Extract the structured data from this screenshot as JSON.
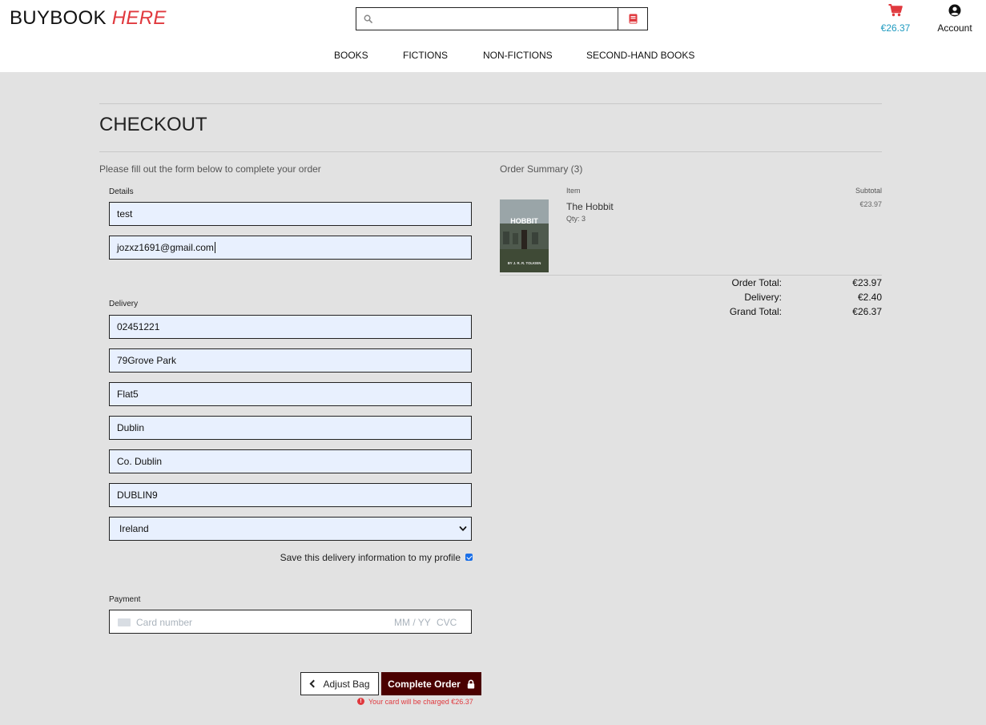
{
  "header": {
    "logo_main": "BUYBOOK",
    "logo_accent": "HERE",
    "search_value": "",
    "cart_amount": "€26.37",
    "account_label": "Account"
  },
  "nav": {
    "items": [
      "BOOKS",
      "FICTIONS",
      "NON-FICTIONS",
      "SECOND-HAND BOOKS"
    ]
  },
  "page": {
    "title": "CHECKOUT",
    "intro": "Please fill out the form below to complete your order"
  },
  "form": {
    "details_label": "Details",
    "full_name": "test",
    "email": "jozxz1691@gmail.com",
    "delivery_label": "Delivery",
    "phone": "02451221",
    "street1": "79Grove Park",
    "street2": "Flat5",
    "town": "Dublin",
    "county": "Co. Dublin",
    "postcode": "DUBLIN9",
    "country": "Ireland",
    "save_info_label": "Save this delivery information to my profile",
    "save_info_checked": true,
    "payment_label": "Payment",
    "card_placeholder": "Card number",
    "expiry_placeholder": "MM / YY",
    "cvc_placeholder": "CVC"
  },
  "actions": {
    "adjust_label": "Adjust Bag",
    "complete_label": "Complete Order",
    "charge_warning": "Your card will be charged €26.37"
  },
  "summary": {
    "title": "Order Summary (3)",
    "col_item": "Item",
    "col_subtotal": "Subtotal",
    "item": {
      "name": "The Hobbit",
      "qty": "Qty: 3",
      "subtotal": "€23.97",
      "cover_title": "HOBBIT",
      "cover_author": "BY J. R. R. TOLKIEN"
    },
    "order_total_label": "Order Total:",
    "order_total": "€23.97",
    "delivery_label": "Delivery:",
    "delivery": "€2.40",
    "grand_total_label": "Grand Total:",
    "grand_total": "€26.37"
  },
  "colors": {
    "accent_red": "#e0393e",
    "cart_blue": "#1f9bc0",
    "complete_button": "#4a0000",
    "autofill_bg": "#e8f0fe"
  }
}
